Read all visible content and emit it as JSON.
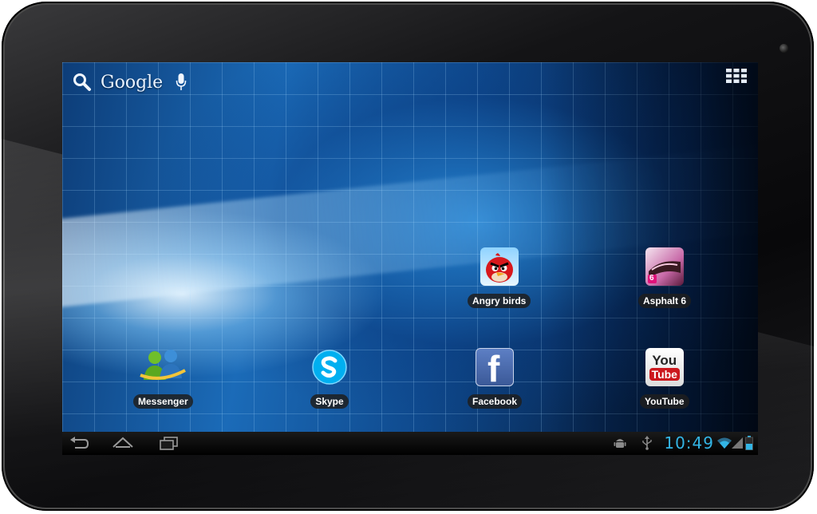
{
  "search": {
    "logo_text": "Google"
  },
  "desktop": {
    "apps": [
      {
        "label": "Angry birds",
        "icon": "angry-birds-icon"
      },
      {
        "label": "Asphalt 6",
        "icon": "asphalt-6-icon"
      },
      {
        "label": "Messenger",
        "icon": "messenger-icon"
      },
      {
        "label": "Skype",
        "icon": "skype-icon"
      },
      {
        "label": "Facebook",
        "icon": "facebook-icon"
      },
      {
        "label": "YouTube",
        "icon": "youtube-icon"
      }
    ],
    "youtube_logo": {
      "top": "You",
      "bottom": "Tube"
    },
    "facebook_logo": "f",
    "asphalt_badge": "6"
  },
  "status_bar": {
    "clock": "10:49",
    "icons": [
      "android-debug-icon",
      "usb-icon",
      "wifi-icon",
      "signal-icon",
      "battery-icon"
    ]
  },
  "nav_bar": {
    "buttons": [
      "back-icon",
      "home-icon",
      "recent-apps-icon"
    ]
  },
  "colors": {
    "clock": "#33b5e5",
    "label_bg": "#1e1e1e",
    "facebook": "#3b5998",
    "youtube_red": "#cc181e",
    "skype": "#00aff0"
  }
}
